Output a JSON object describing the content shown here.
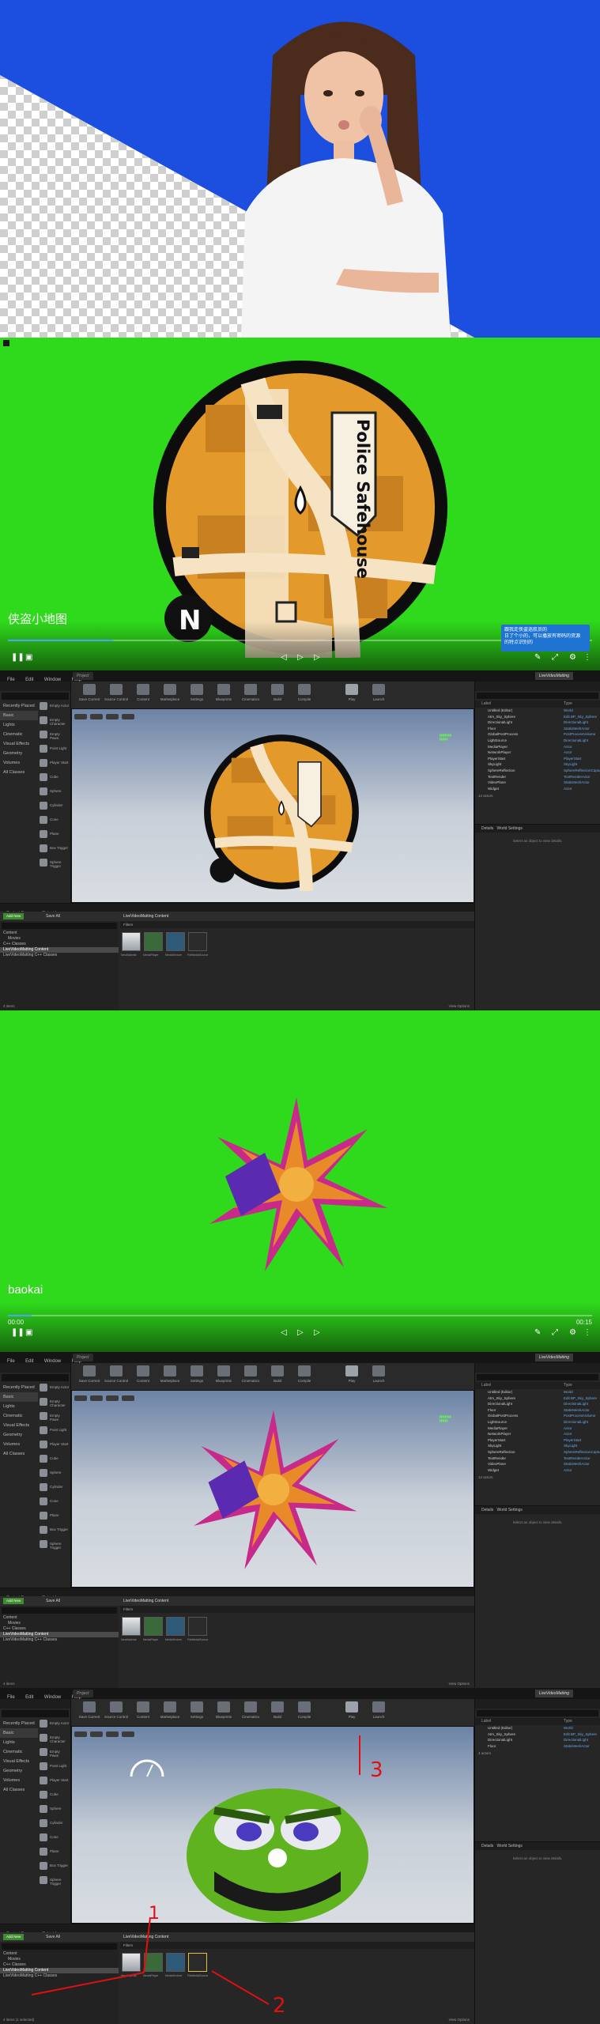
{
  "videos": [
    {
      "title": "侠盗小地图",
      "time_current": "",
      "time_total": "",
      "tooltip": [
        "跟我走侠盗巡航员的",
        "日了个小的，可以播放有密码的资源",
        "的特点识别的"
      ],
      "map_label": "Police Safehouse",
      "compass": "N"
    },
    {
      "title": "baokai",
      "time_current": "00:00",
      "time_total": "00:15"
    }
  ],
  "editors": [
    {
      "tabs": [
        "",
        "Project"
      ],
      "project_tab": "LiveVideoMatting",
      "content_path": "LiveVideoMatting Content",
      "status": "4 items",
      "outliner_footer": "14 actors",
      "view_options": "View Options"
    },
    {
      "tabs": [
        "",
        "Project"
      ],
      "project_tab": "LiveVideoMatting",
      "content_path": "LiveVideoMatting Content",
      "status": "4 items",
      "outliner_footer": "14 actors",
      "view_options": "View Options"
    },
    {
      "tabs": [
        "",
        "Project"
      ],
      "project_tab": "LiveVideoMatting",
      "content_path": "LiveVideoMatting Content",
      "status": "4 items (1 selected)",
      "outliner_footer": "4 actors",
      "view_options": "View Options",
      "annotations": [
        "1",
        "2",
        "3"
      ]
    }
  ],
  "editor": {
    "menu": [
      "File",
      "Edit",
      "Window",
      "Help"
    ],
    "toolbar": [
      "Save Current",
      "Source Control",
      "Content",
      "Marketplace",
      "Settings",
      "Blueprints",
      "Cinematics",
      "Build",
      "Compile",
      "Play",
      "Launch"
    ],
    "modes_title": "Place Mode",
    "categories": [
      "Recently Placed",
      "Basic",
      "Lights",
      "Cinematic",
      "Visual Effects",
      "Geometry",
      "Volumes",
      "All Classes"
    ],
    "place_items": [
      "Empty Actor",
      "Empty Character",
      "Empty Pawn",
      "Point Light",
      "Player Start",
      "Cube",
      "Sphere",
      "Cylinder",
      "Cone",
      "Plane",
      "Box Trigger",
      "Sphere Trigger"
    ],
    "outliner_title": "World Outliner",
    "outliner_cols": [
      "Label",
      "Type"
    ],
    "outliner_rows": [
      {
        "label": "Untitled (Editor)",
        "type": "World"
      },
      {
        "label": "Atm_Sky_Sphere",
        "type": "Edit BP_Sky_Sphere"
      },
      {
        "label": "DirectionalLight",
        "type": "DirectionalLight"
      },
      {
        "label": "Floor",
        "type": "StaticMeshActor"
      },
      {
        "label": "GlobalPostProcess",
        "type": "PostProcessVolume"
      },
      {
        "label": "LightSource",
        "type": "DirectionalLight"
      },
      {
        "label": "MediaPlayer",
        "type": "Actor"
      },
      {
        "label": "NetworkPlayer",
        "type": "Actor"
      },
      {
        "label": "PlayerStart",
        "type": "PlayerStart"
      },
      {
        "label": "SkyLight",
        "type": "SkyLight"
      },
      {
        "label": "SphereReflection",
        "type": "SphereReflectionCapture"
      },
      {
        "label": "TextRender",
        "type": "TextRenderActor"
      },
      {
        "label": "VideoPlane",
        "type": "StaticMeshActor"
      },
      {
        "label": "Widget",
        "type": "Actor"
      }
    ],
    "details_tabs": [
      "Details",
      "World Settings"
    ],
    "details_empty": "Select an object to view details.",
    "cb_tabs": [
      "Content Browser",
      "Output Log"
    ],
    "add_new": "Add New",
    "save_all": "Save All",
    "tree": [
      "Content",
      "Movies",
      "C++ Classes",
      "LiveVideoMatting Content",
      "LiveVideoMatting C++ Classes"
    ],
    "filters": "Filters",
    "assets": [
      "NewMaterial",
      "MediaPlayer",
      "MediaTexture",
      "FileMediaSource"
    ],
    "viewport_buttons": [
      "Perspective",
      "Lit",
      "Show"
    ]
  },
  "colors": {
    "green_screen": "#2fd91b",
    "blue_bg": "#1c4fe0",
    "ue_dark": "#222222",
    "annotation": "#e01010",
    "progress": "#4fa3ff"
  }
}
